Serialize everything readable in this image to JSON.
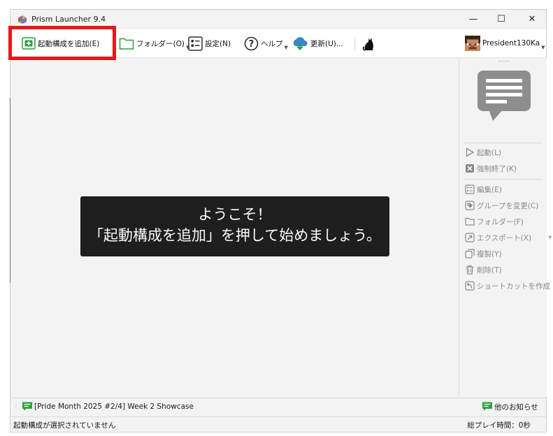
{
  "window": {
    "title": "Prism Launcher 9.4",
    "minimize": "—",
    "maximize": "☐",
    "close": "✕"
  },
  "toolbar": {
    "add_instance": "起動構成を追加(E)",
    "folders": "フォルダー(O)",
    "settings": "設定(N)",
    "help": "ヘルプ",
    "update": "更新(U)...",
    "account": "President130Ka"
  },
  "welcome": {
    "line1": "ようこそ！",
    "line2": "「起動構成を追加」を押して始めましょう。"
  },
  "sidebar": {
    "launch": "起動(L)",
    "kill": "強制終了(K)",
    "edit": "編集(E)",
    "change_group": "グループを変更(C)",
    "folder": "フォルダー(F)",
    "export": "エクスポート(X)",
    "copy": "複製(Y)",
    "delete": "削除(T)",
    "shortcut": "ショートカットを作成"
  },
  "news": {
    "headline": "[Pride Month 2025 #2/4] Week 2 Showcase",
    "more": "他のお知らせ"
  },
  "status": {
    "selection": "起動構成が選択されていません",
    "playtime": "総プレイ時間：0秒"
  },
  "colors": {
    "accent_green": "#2e9e3c",
    "highlight_red": "#e81818",
    "welcome_bg": "#1e1e1e"
  }
}
